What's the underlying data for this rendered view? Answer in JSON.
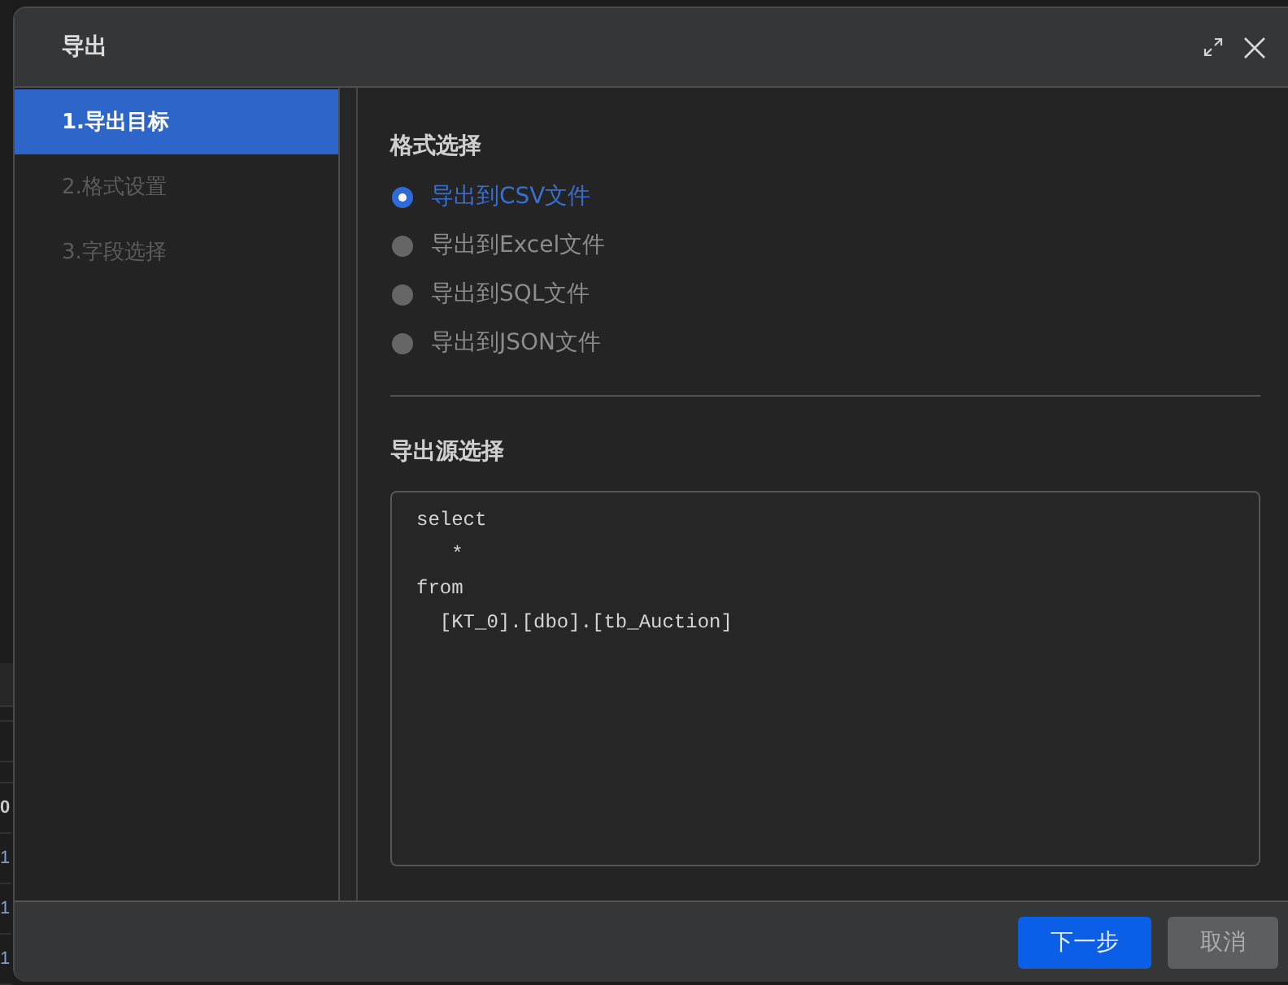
{
  "background_table": {
    "cells": [
      {
        "text": "0",
        "kind": "header"
      },
      {
        "text": "1",
        "kind": "data"
      },
      {
        "text": "1",
        "kind": "data"
      },
      {
        "text": "1",
        "kind": "data"
      }
    ]
  },
  "dialog": {
    "title": "导出"
  },
  "steps": [
    {
      "label": "1.导出目标",
      "selected": true
    },
    {
      "label": "2.格式设置",
      "selected": false
    },
    {
      "label": "3.字段选择",
      "selected": false
    }
  ],
  "format": {
    "heading": "格式选择",
    "options": [
      {
        "label": "导出到CSV文件",
        "selected": true
      },
      {
        "label": "导出到Excel文件",
        "selected": false
      },
      {
        "label": "导出到SQL文件",
        "selected": false
      },
      {
        "label": "导出到JSON文件",
        "selected": false
      }
    ]
  },
  "source": {
    "heading": "导出源选择",
    "lines": [
      "select",
      "   *",
      "from",
      "  [KT_0].[dbo].[tb_Auction]"
    ]
  },
  "buttons": [
    {
      "label": "下一步",
      "kind": "primary"
    },
    {
      "label": "取消",
      "kind": "secondary"
    }
  ]
}
